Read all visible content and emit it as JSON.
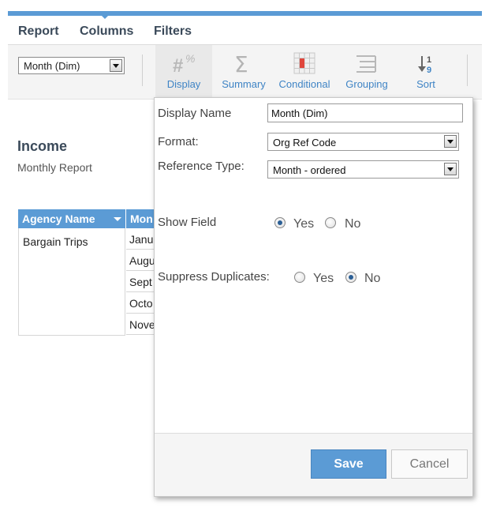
{
  "colors": {
    "accent": "#5b9bd5",
    "toolbar_label": "#3f84c5"
  },
  "menu": {
    "items": [
      "Report",
      "Columns",
      "Filters"
    ]
  },
  "toolbar": {
    "field_select_value": "Month (Dim)",
    "buttons": [
      {
        "label": "Display",
        "icon": "display-format-icon",
        "active": true
      },
      {
        "label": "Summary",
        "icon": "sigma-icon"
      },
      {
        "label": "Conditional",
        "icon": "conditional-grid-icon"
      },
      {
        "label": "Grouping",
        "icon": "grouping-lines-icon"
      },
      {
        "label": "Sort",
        "icon": "sort-1-9-icon"
      }
    ]
  },
  "report": {
    "title": "Income",
    "subtitle": "Monthly Report"
  },
  "grid": {
    "headers": [
      "Agency Name",
      "Mon"
    ],
    "agency": "Bargain Trips",
    "months": [
      "Janu",
      "Augu",
      "Sept",
      "Octo",
      "Nove"
    ]
  },
  "panel": {
    "display_name_label": "Display Name",
    "display_name_value": "Month (Dim)",
    "format_label": "Format:",
    "format_value": "Org Ref Code",
    "reference_type_label": "Reference Type:",
    "reference_type_value": "Month - ordered",
    "show_field_label": "Show Field",
    "show_field_selected": "Yes",
    "suppress_label": "Suppress Duplicates:",
    "suppress_selected": "No",
    "yes": "Yes",
    "no": "No",
    "save": "Save",
    "cancel": "Cancel"
  }
}
